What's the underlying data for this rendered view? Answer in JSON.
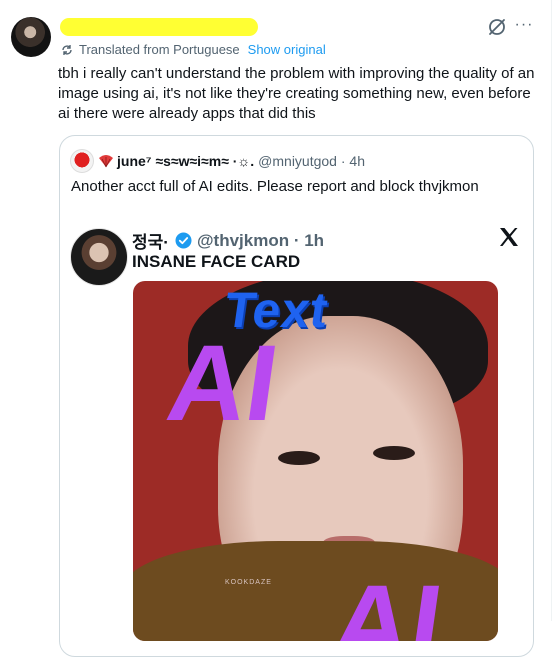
{
  "tweet": {
    "author_redacted": "",
    "translated_label": "Translated from Portuguese",
    "show_original": "Show original",
    "text": "tbh i really can't understand the problem with improving the quality of an image using ai, it's not like they're creating something new, even before ai there were already apps that did this",
    "more_label": "···"
  },
  "quote": {
    "name": "june⁷ ≈s≈w≈i≈m≈ ·☼.",
    "handle": "@mniyutgod · 4h",
    "text": "Another acct full of AI edits. Please report and block thvjkmon"
  },
  "inner_tweet": {
    "name": "정국·",
    "handle": "@thvjkmon · 1h",
    "title": "INSANE FACE CARD"
  },
  "image": {
    "overlay_text": "Text",
    "overlay_ai_1": "AI",
    "overlay_ai_2": "AI",
    "watermark": "KOOKDAZE"
  },
  "icons": {
    "hide": "hide-reply-icon",
    "more": "more-icon",
    "translate": "translate-icon",
    "fan": "fan-icon",
    "verified": "verified-icon",
    "x_logo": "x-logo-icon"
  },
  "colors": {
    "link": "#1d9bf0",
    "muted": "#536471",
    "redaction": "#ffff33",
    "verified": "#1d9bf0",
    "overlay_blue": "#1f63f0",
    "overlay_purple": "#b84af0",
    "photo_bg": "#9d2b26"
  }
}
